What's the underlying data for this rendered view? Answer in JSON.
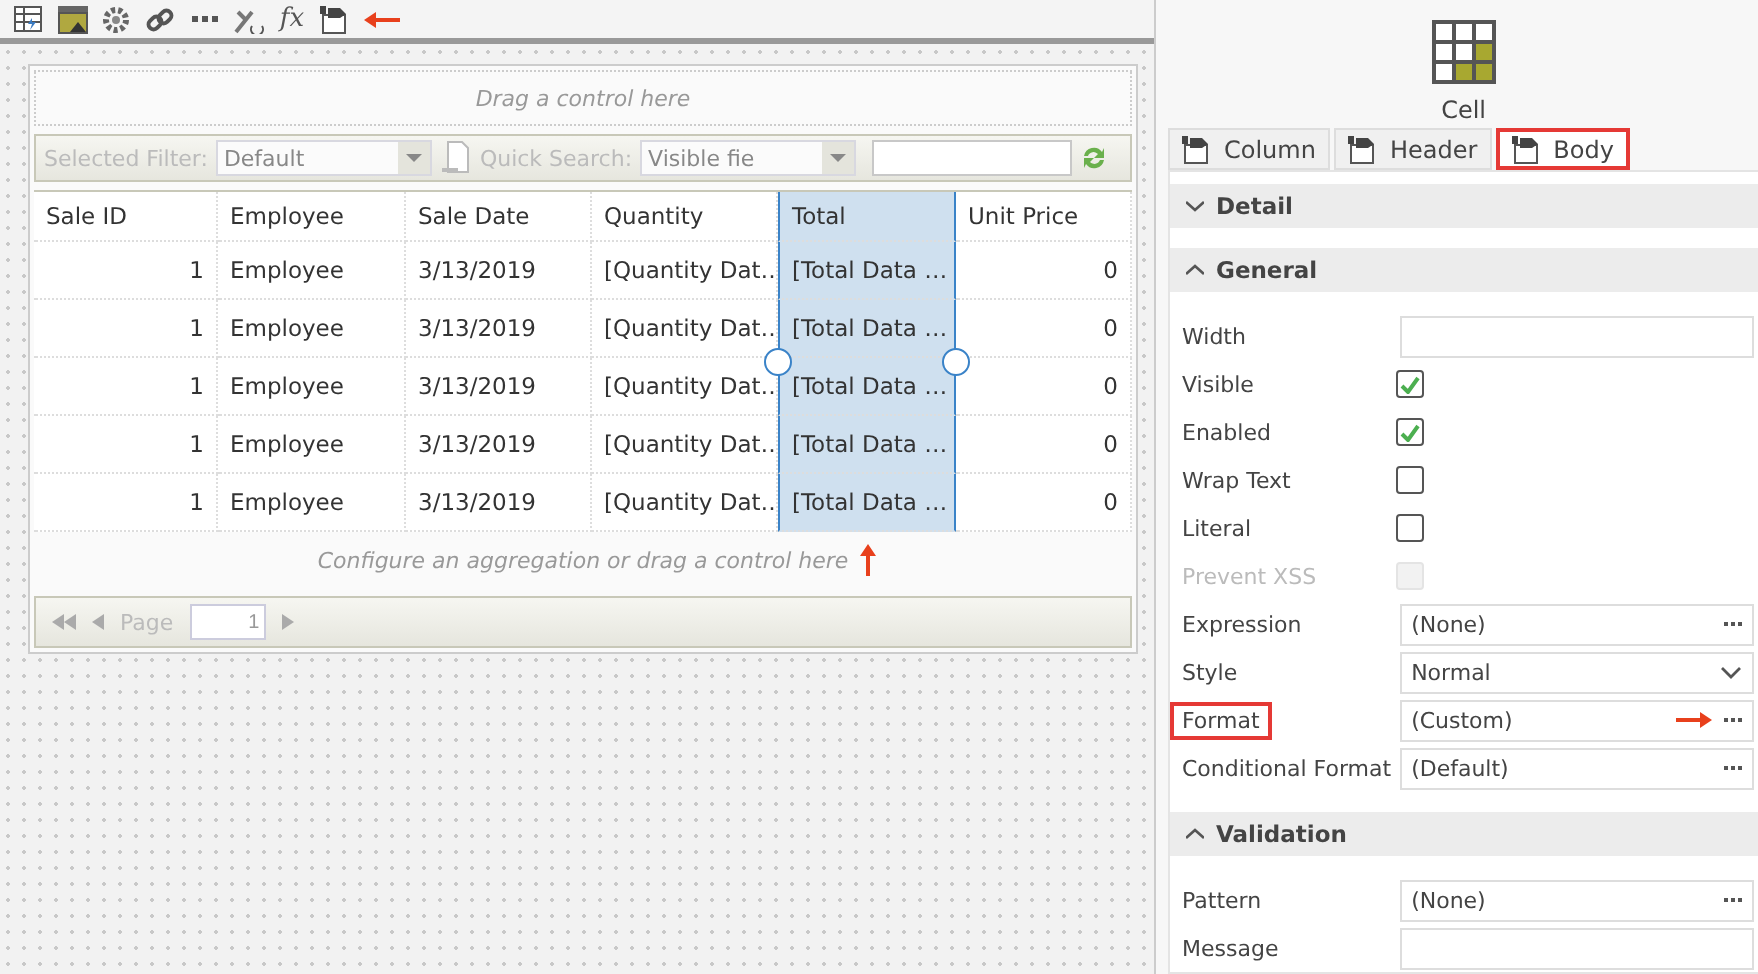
{
  "toolbar": [
    {
      "kind": "table",
      "arrow": false
    },
    {
      "kind": "image",
      "arrow": false
    },
    {
      "kind": "gear",
      "arrow": false
    },
    {
      "kind": "link",
      "arrow": false
    },
    {
      "kind": "dots",
      "arrow": false
    },
    {
      "kind": "tools",
      "arrow": false
    },
    {
      "kind": "fx",
      "label": "fx",
      "arrow": false
    },
    {
      "kind": "cell",
      "arrow": true
    }
  ],
  "grid": {
    "drop_hint": "Drag a control here",
    "filter": {
      "filter_label": "Selected Filter:",
      "filter_value": "Default",
      "search_label": "Quick Search:",
      "search_value": "Visible fie"
    },
    "columns": [
      {
        "label": "Sale ID",
        "kind": "number",
        "selected": false,
        "arrow": false
      },
      {
        "label": "Employee",
        "kind": "text",
        "selected": false,
        "arrow": false
      },
      {
        "label": "Sale Date",
        "kind": "text",
        "selected": false,
        "arrow": false
      },
      {
        "label": "Quantity",
        "kind": "text",
        "selected": false,
        "arrow": false
      },
      {
        "label": "Total",
        "kind": "text",
        "selected": true,
        "arrow": true
      },
      {
        "label": "Unit Price",
        "kind": "number",
        "selected": false,
        "arrow": false
      }
    ],
    "rows": [
      [
        "1",
        "Employee",
        "3/13/2019",
        "[Quantity Dat…",
        "[Total Data …",
        "0"
      ],
      [
        "1",
        "Employee",
        "3/13/2019",
        "[Quantity Dat…",
        "[Total Data …",
        "0"
      ],
      [
        "1",
        "Employee",
        "3/13/2019",
        "[Quantity Dat…",
        "[Total Data …",
        "0"
      ],
      [
        "1",
        "Employee",
        "3/13/2019",
        "[Quantity Dat…",
        "[Total Data …",
        "0"
      ],
      [
        "1",
        "Employee",
        "3/13/2019",
        "[Quantity Dat…",
        "[Total Data …",
        "0"
      ]
    ],
    "footer_hint": "Configure an aggregation or drag a control here",
    "pager": {
      "label": "Page",
      "placeholder": "1"
    }
  },
  "panel": {
    "title": "Cell",
    "tabs": [
      {
        "label": "Column",
        "selected": false,
        "highlighted": false
      },
      {
        "label": "Header",
        "selected": false,
        "highlighted": false
      },
      {
        "label": "Body",
        "selected": true,
        "highlighted": true
      }
    ],
    "sections": [
      {
        "title": "Detail",
        "expanded": false
      },
      {
        "title": "General",
        "expanded": true,
        "properties": [
          {
            "label": "Width",
            "kind": "text",
            "highlighted": false
          },
          {
            "label": "Visible",
            "kind": "checkbox",
            "checked": true,
            "disabled": false,
            "highlighted": false
          },
          {
            "label": "Enabled",
            "kind": "checkbox",
            "checked": true,
            "disabled": false,
            "highlighted": false
          },
          {
            "label": "Wrap Text",
            "kind": "checkbox",
            "checked": false,
            "disabled": false,
            "highlighted": false
          },
          {
            "label": "Literal",
            "kind": "checkbox",
            "checked": false,
            "disabled": false,
            "highlighted": false
          },
          {
            "label": "Prevent XSS",
            "kind": "checkbox",
            "checked": false,
            "disabled": true,
            "highlighted": false
          },
          {
            "label": "Expression",
            "kind": "ellipsis",
            "value": "(None)",
            "highlighted": false,
            "arrow": false
          },
          {
            "label": "Style",
            "kind": "dropdown",
            "value": "Normal",
            "highlighted": false
          },
          {
            "label": "Format",
            "kind": "ellipsis",
            "value": "(Custom)",
            "highlighted": true,
            "arrow": true
          },
          {
            "label": "Conditional Format",
            "kind": "ellipsis",
            "value": "(Default)",
            "highlighted": false,
            "arrow": false
          }
        ]
      },
      {
        "title": "Validation",
        "expanded": true,
        "properties": [
          {
            "label": "Pattern",
            "kind": "ellipsis",
            "value": "(None)",
            "highlighted": false,
            "arrow": false
          },
          {
            "label": "Message",
            "kind": "text",
            "highlighted": false
          }
        ]
      }
    ]
  }
}
